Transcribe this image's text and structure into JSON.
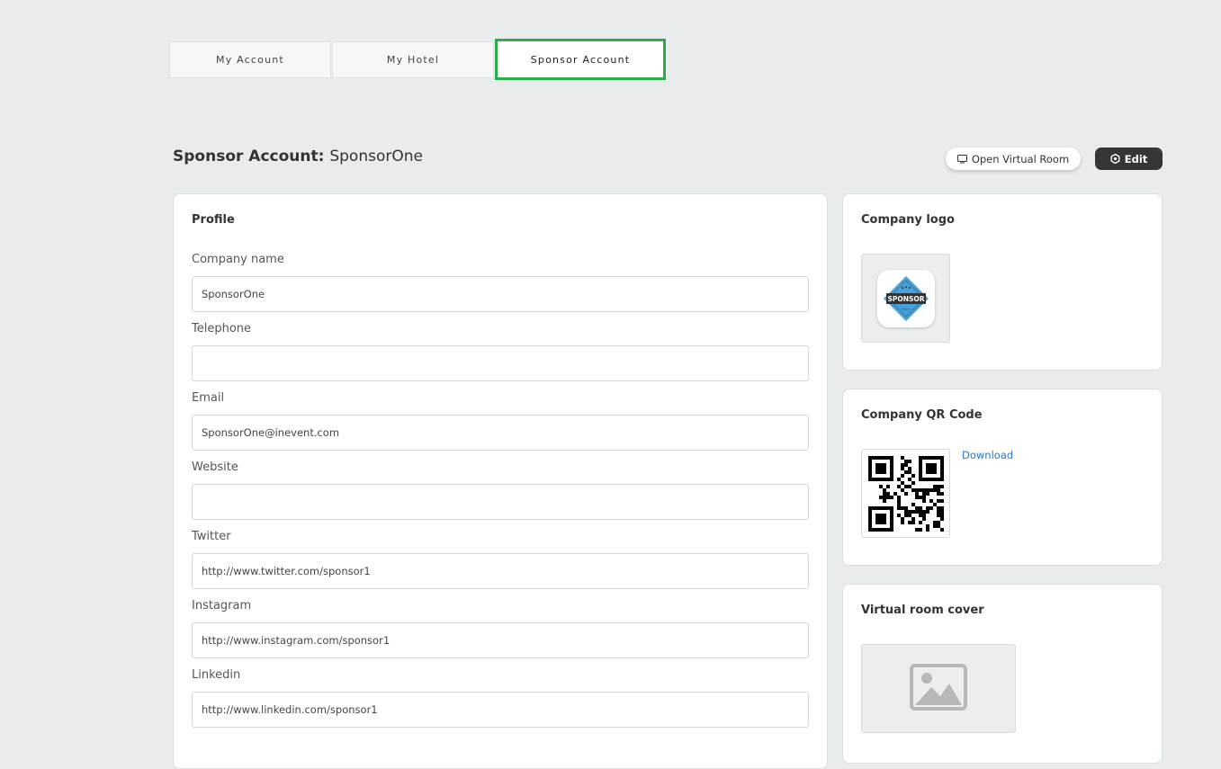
{
  "tabs": [
    {
      "label": "My Account"
    },
    {
      "label": "My Hotel"
    },
    {
      "label": "Sponsor Account",
      "active": true
    }
  ],
  "header": {
    "title_prefix": "Sponsor Account: ",
    "title_name": "SponsorOne",
    "open_virtual_room_label": "Open Virtual Room",
    "edit_label": "Edit"
  },
  "profile": {
    "heading": "Profile",
    "fields": [
      {
        "label": "Company name",
        "value": "SponsorOne"
      },
      {
        "label": "Telephone",
        "value": ""
      },
      {
        "label": "Email",
        "value": "SponsorOne@inevent.com"
      },
      {
        "label": "Website",
        "value": ""
      },
      {
        "label": "Twitter",
        "value": "http://www.twitter.com/sponsor1"
      },
      {
        "label": "Instagram",
        "value": "http://www.instagram.com/sponsor1"
      },
      {
        "label": "Linkedin",
        "value": "http://www.linkedin.com/sponsor1"
      }
    ]
  },
  "company_logo": {
    "heading": "Company logo",
    "logo_text": "SPONSOR"
  },
  "company_qr": {
    "heading": "Company QR Code",
    "download_label": "Download"
  },
  "virtual_room_cover": {
    "heading": "Virtual room cover",
    "icon": "image-placeholder-icon"
  },
  "colors": {
    "active_tab_border": "#2eab4a",
    "edit_button_bg": "#363636",
    "link": "#2a77c9",
    "page_bg": "#e9ecec"
  }
}
